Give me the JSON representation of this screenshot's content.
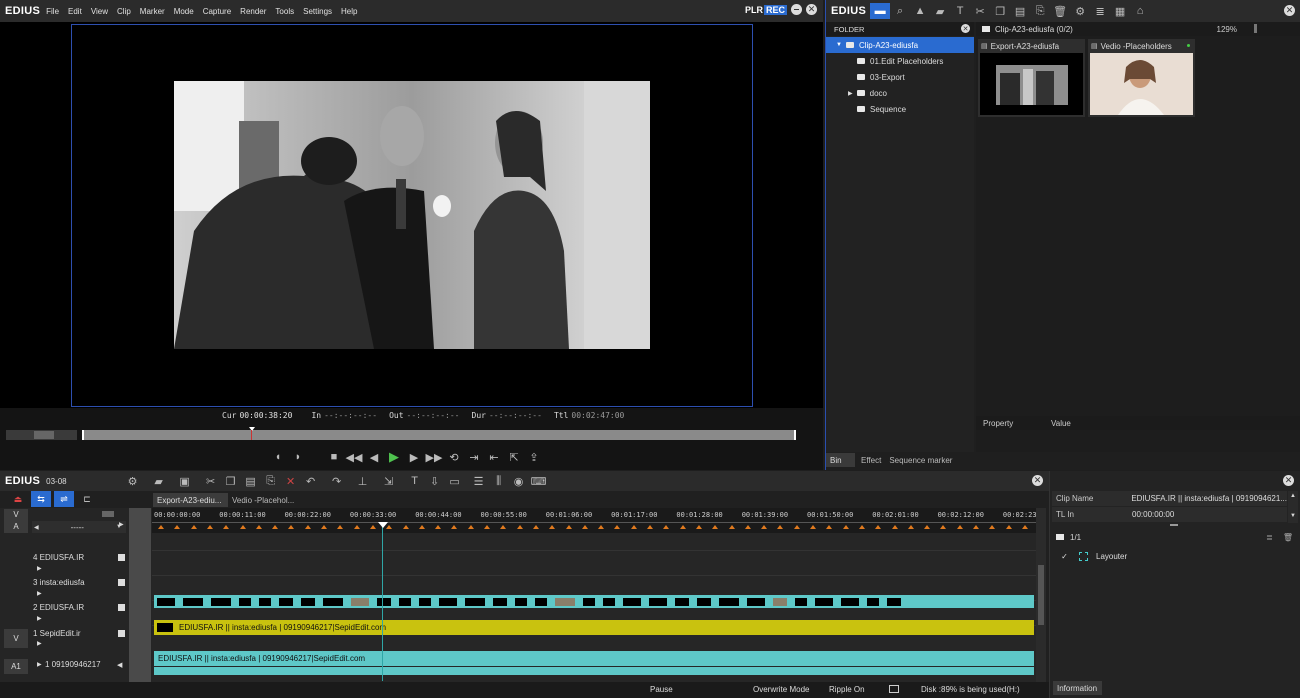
{
  "player": {
    "logo": "EDIUS",
    "menu": [
      "File",
      "Edit",
      "View",
      "Clip",
      "Marker",
      "Mode",
      "Capture",
      "Render",
      "Tools",
      "Settings",
      "Help"
    ],
    "mode_plr": "PLR",
    "mode_rec": "REC",
    "timecodes": {
      "cur_label": "Cur",
      "cur": "00:00:38:20",
      "in_label": "In",
      "in": "--:--:--:--",
      "out_label": "Out",
      "out": "--:--:--:--",
      "dur_label": "Dur",
      "dur": "--:--:--:--",
      "ttl_label": "Ttl",
      "ttl": "00:02:47:00"
    }
  },
  "bin": {
    "logo": "EDIUS",
    "folder_header": "FOLDER",
    "breadcrumb": "Clip-A23-ediusfa (0/2)",
    "zoom": "129%",
    "tree": [
      {
        "label": "Clip-A23-ediusfa",
        "selected": true
      },
      {
        "label": "01.Edit Placeholders"
      },
      {
        "label": "03-Export"
      },
      {
        "label": "doco"
      },
      {
        "label": "Sequence"
      }
    ],
    "clips": [
      {
        "title": "Export-A23-ediusfa"
      },
      {
        "title": "Vedio -Placeholders"
      }
    ],
    "property_col": "Property",
    "value_col": "Value",
    "tabs": [
      "Bin",
      "Effect",
      "Sequence marker"
    ]
  },
  "timeline": {
    "logo": "EDIUS",
    "sequence": "03-08",
    "seq_tabs": [
      "Export-A23-ediu...",
      "Vedio -Placehol..."
    ],
    "dropdown": "-----",
    "header_v": "V",
    "header_a": "A",
    "ruler": [
      "00:00:00:00",
      "00:00:11:00",
      "00:00:22:00",
      "00:00:33:00",
      "00:00:44:00",
      "00:00:55:00",
      "00:01:06:00",
      "00:01:17:00",
      "00:01:28:00",
      "00:01:39:00",
      "00:01:50:00",
      "00:02:01:00",
      "00:02:12:00",
      "00:02:23"
    ],
    "tracks": [
      {
        "name": "4 EDIUSFA.IR"
      },
      {
        "name": "3 insta:ediusfa"
      },
      {
        "name": "2 EDIUSFA.IR"
      },
      {
        "name": "1 SepidEdit.ir",
        "tag": "V"
      },
      {
        "name": "1 09190946217",
        "tag": "A1"
      }
    ],
    "v1_clip": "EDIUSFA.IR || insta:ediusfa |  09190946217|SepidEdit.com",
    "a1_clip": "EDIUSFA.IR || insta:ediusfa |  09190946217|SepidEdit.com"
  },
  "info": {
    "clip_name_label": "Clip Name",
    "clip_name": "EDIUSFA.IR || insta:ediusfa | 0919094621...",
    "tl_in_label": "TL In",
    "tl_in": "00:00:00:00",
    "page": "1/1",
    "effect": "Layouter",
    "tab": "Information"
  },
  "status": {
    "pause": "Pause",
    "mode": "Overwrite Mode",
    "ripple": "Ripple On",
    "disk": "Disk :89% is being used(H:)"
  },
  "colors": {
    "accent": "#2a6bd0",
    "clip_cyan": "#5ec8c8",
    "clip_yellow": "#c9c20f",
    "marker": "#e07a1f"
  }
}
